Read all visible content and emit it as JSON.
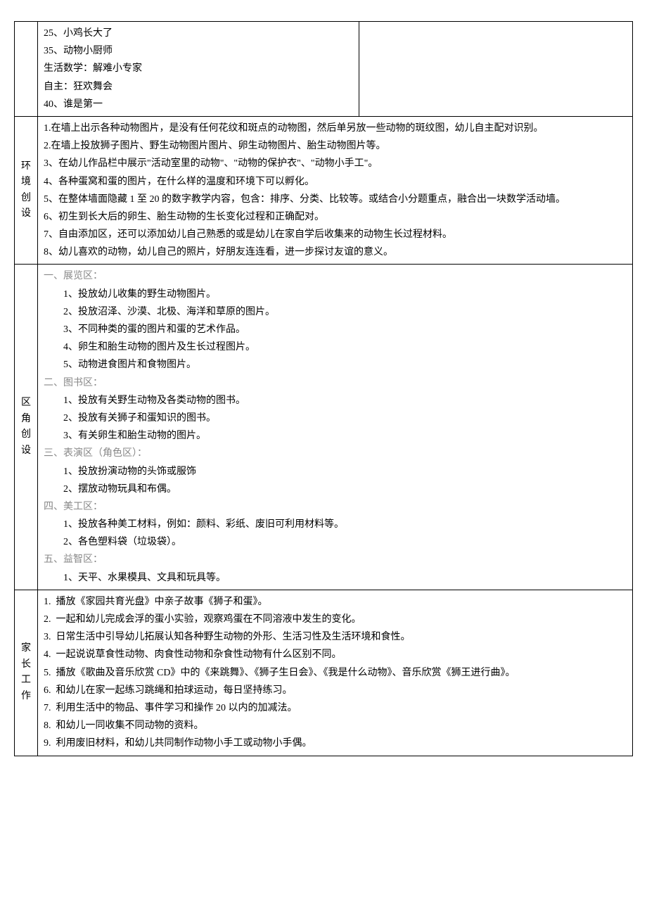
{
  "row1": {
    "label": "",
    "left": [
      "25、小鸡长大了",
      "35、动物小厨师",
      "生活数学：解难小专家",
      "自主：狂欢舞会",
      "40、谁是第一",
      "",
      ""
    ],
    "right": ""
  },
  "row2": {
    "label": "环境创设",
    "lines": [
      "1.在墙上出示各种动物图片，是没有任何花纹和斑点的动物图，然后单另放一些动物的斑纹图，幼儿自主配对识别。",
      "2.在墙上投放狮子图片、野生动物图片图片、卵生动物图片、胎生动物图片等。",
      "3、在幼儿作品栏中展示\"活动室里的动物\"、\"动物的保护衣\"、\"动物小手工\"。",
      "4、各种蛋窝和蛋的图片，在什么样的温度和环境下可以孵化。",
      "5、在整体墙面隐藏 1 至 20 的数字教学内容，包含：排序、分类、比较等。或结合小分题重点，融合出一块数学活动墙。",
      "6、初生到长大后的卵生、胎生动物的生长变化过程和正确配对。",
      "7、自由添加区，还可以添加幼儿自己熟悉的或是幼儿在家自学后收集来的动物生长过程材料。",
      "8、幼儿喜欢的动物，幼儿自己的照片，好朋友连连看，进一步探讨友谊的意义。"
    ]
  },
  "row3": {
    "label": "区角创设",
    "sections": [
      {
        "header": "一、展览区：",
        "items": [
          "1、投放幼儿收集的野生动物图片。",
          "2、投放沼泽、沙漠、北极、海洋和草原的图片。",
          "3、不同种类的蛋的图片和蛋的艺术作品。",
          "4、卵生和胎生动物的图片及生长过程图片。",
          "5、动物进食图片和食物图片。"
        ]
      },
      {
        "header": "二、图书区：",
        "items": [
          "1、投放有关野生动物及各类动物的图书。",
          "2、投放有关狮子和蛋知识的图书。",
          "3、有关卵生和胎生动物的图片。"
        ]
      },
      {
        "header": "三、表演区（角色区）：",
        "items": [
          "1、投放扮演动物的头饰或服饰",
          "2、摆放动物玩具和布偶。"
        ]
      },
      {
        "header": "四、美工区：",
        "items": [
          "1、投放各种美工材料，例如：颜料、彩纸、废旧可利用材料等。",
          "2、各色塑料袋（垃圾袋）。"
        ]
      },
      {
        "header": "五、益智区：",
        "items": [
          "1、天平、水果模具、文具和玩具等。"
        ]
      }
    ]
  },
  "row4": {
    "label": "家长工作",
    "lines": [
      "1.  播放《家园共育光盘》中亲子故事《狮子和蛋》。",
      "2.  一起和幼儿完成会浮的蛋小实验，观察鸡蛋在不同溶液中发生的变化。",
      "3.  日常生活中引导幼儿拓展认知各种野生动物的外形、生活习性及生活环境和食性。",
      "4.  一起说说草食性动物、肉食性动物和杂食性动物有什么区别不同。",
      "5.  播放《歌曲及音乐欣赏 CD》中的《来跳舞》、《狮子生日会》、《我是什么动物》、音乐欣赏《狮王进行曲》。",
      "6.  和幼儿在家一起练习跳绳和拍球运动，每日坚持练习。",
      "7.  利用生活中的物品、事件学习和操作 20 以内的加减法。",
      "8.  和幼儿一同收集不同动物的资料。",
      "9.  利用废旧材料，和幼儿共同制作动物小手工或动物小手偶。"
    ]
  }
}
